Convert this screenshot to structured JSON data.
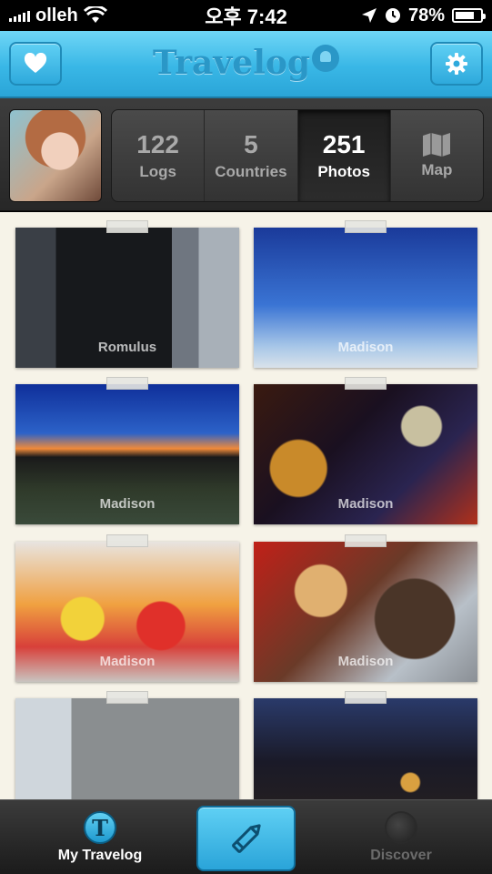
{
  "status_bar": {
    "carrier": "olleh",
    "time": "오후 7:42",
    "battery": "78%",
    "battery_level": 0.78
  },
  "header": {
    "title": "Travelog",
    "left_icon": "heart-icon",
    "right_icon": "gear-icon",
    "accent_color": "#39b7e6"
  },
  "profile": {
    "stats": [
      {
        "num": "122",
        "label": "Logs"
      },
      {
        "num": "5",
        "label": "Countries"
      },
      {
        "num": "251",
        "label": "Photos",
        "active": true
      },
      {
        "num": "",
        "label": "Map",
        "icon": "map-icon"
      }
    ]
  },
  "photos": [
    {
      "caption": "Romulus"
    },
    {
      "caption": "Madison"
    },
    {
      "caption": "Madison"
    },
    {
      "caption": "Madison"
    },
    {
      "caption": "Madison"
    },
    {
      "caption": "Madison"
    },
    {
      "caption": ""
    },
    {
      "caption": ""
    }
  ],
  "tab_bar": {
    "tabs": [
      {
        "label": "My Travelog",
        "icon": "travelog-t-icon",
        "active": true
      },
      {
        "label": "",
        "icon": "pencil-icon"
      },
      {
        "label": "Discover",
        "icon": "globe-icon"
      }
    ]
  }
}
